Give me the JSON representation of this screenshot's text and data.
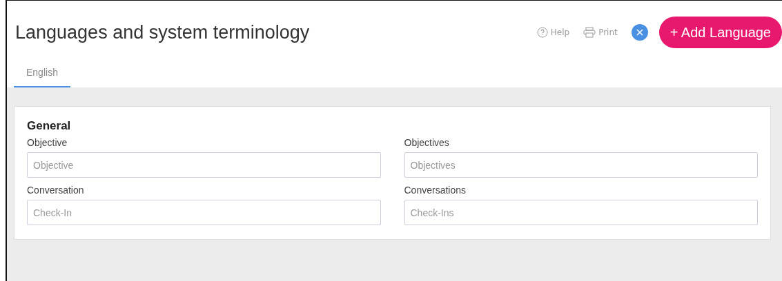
{
  "header": {
    "title": "Languages and system terminology",
    "help": "Help",
    "print": "Print",
    "add_button": "+ Add Language"
  },
  "tabs": [
    {
      "label": "English",
      "selected": true
    }
  ],
  "section": {
    "title": "General",
    "fields": [
      {
        "label": "Objective",
        "placeholder": "Objective"
      },
      {
        "label": "Objectives",
        "placeholder": "Objectives"
      },
      {
        "label": "Conversation",
        "placeholder": "Check-In"
      },
      {
        "label": "Conversations",
        "placeholder": "Check-Ins"
      }
    ]
  }
}
